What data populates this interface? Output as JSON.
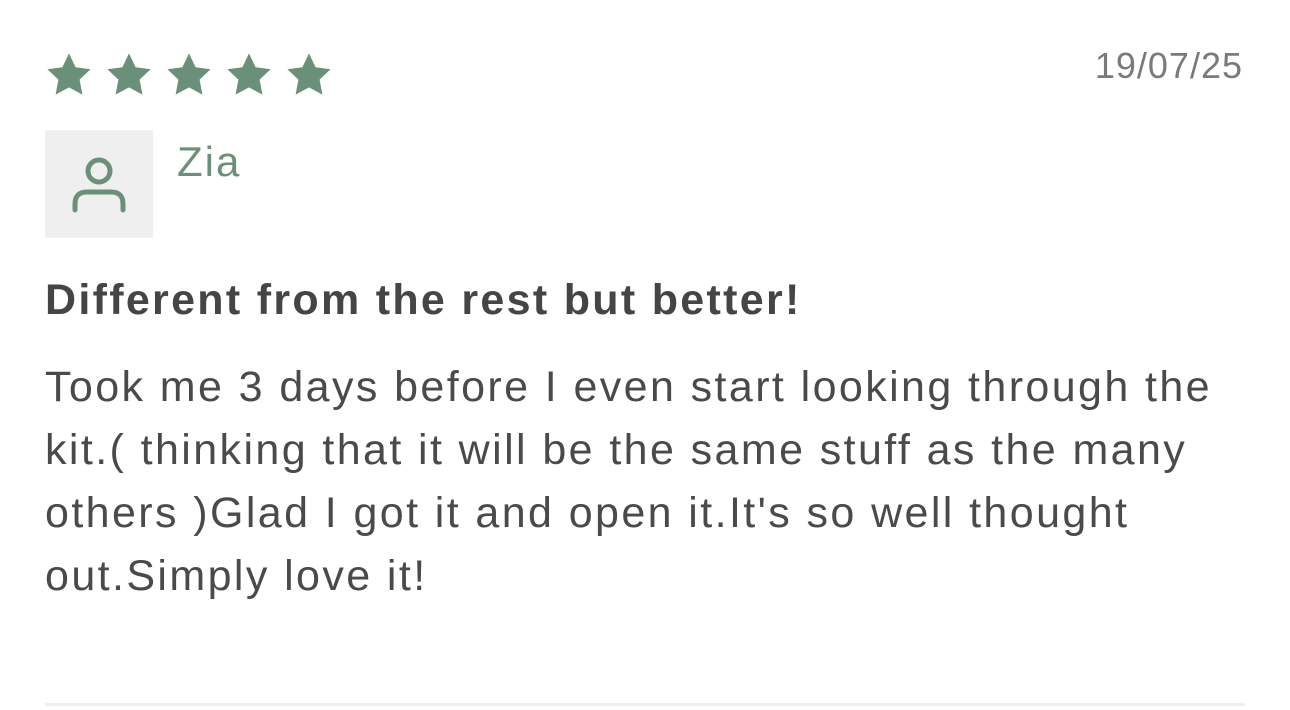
{
  "review": {
    "rating": 5,
    "rating_max": 5,
    "date": "19/07/25",
    "author": "Zia",
    "title": "Different from the rest but better!",
    "body": "Took me 3 days before I even start looking through the kit.( thinking that it will be the same stuff as the many others )Glad I got it and open it.It's so well thought out.Simply love it!"
  },
  "icons": {
    "star": "star-icon",
    "avatar": "user-icon"
  },
  "colors": {
    "accent": "#6a9079",
    "star": "#6a9079",
    "avatar_bg": "#efefef",
    "date": "#7a7a7a",
    "title": "#454545",
    "body": "#4a4a4a",
    "divider": "#efefef"
  }
}
